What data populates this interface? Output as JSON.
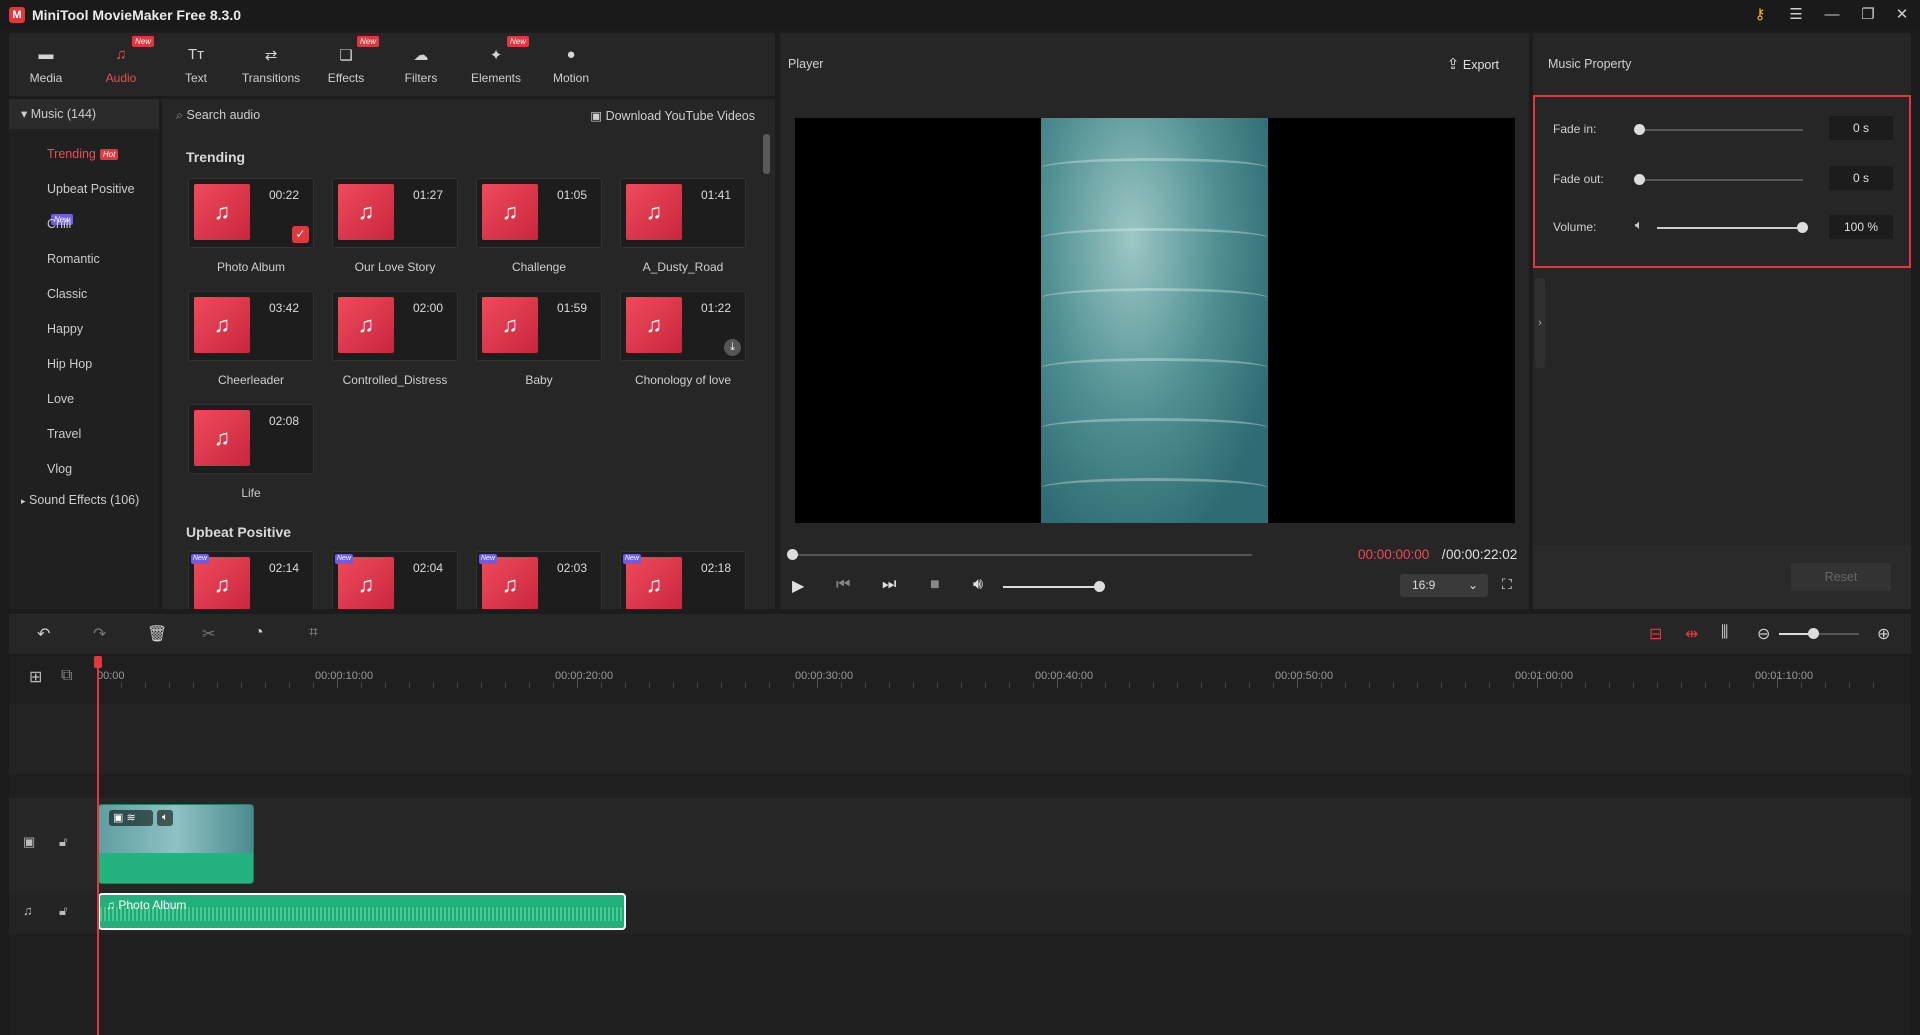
{
  "app": {
    "title": "MiniTool MovieMaker Free 8.3.0",
    "logo_letter": "M"
  },
  "toolbar": {
    "items": [
      {
        "label": "Media",
        "new": false,
        "active": false
      },
      {
        "label": "Audio",
        "new": true,
        "active": true
      },
      {
        "label": "Text",
        "new": false,
        "active": false
      },
      {
        "label": "Transitions",
        "new": false,
        "active": false
      },
      {
        "label": "Effects",
        "new": true,
        "active": false
      },
      {
        "label": "Filters",
        "new": false,
        "active": false
      },
      {
        "label": "Elements",
        "new": true,
        "active": false
      },
      {
        "label": "Motion",
        "new": false,
        "active": false
      }
    ],
    "new_tag": "New"
  },
  "sidebar": {
    "music_header": "Music (144)",
    "categories": [
      {
        "label": "Trending",
        "badge": "Hot"
      },
      {
        "label": "Upbeat Positive",
        "badge": "New"
      },
      {
        "label": "Chill"
      },
      {
        "label": "Romantic"
      },
      {
        "label": "Classic"
      },
      {
        "label": "Happy"
      },
      {
        "label": "Hip Hop"
      },
      {
        "label": "Love"
      },
      {
        "label": "Travel"
      },
      {
        "label": "Vlog"
      }
    ],
    "sound_effects": "Sound Effects (106)"
  },
  "library": {
    "search_placeholder": "Search audio",
    "download_label": "Download YouTube Videos",
    "section1": "Trending",
    "section2": "Upbeat Positive",
    "trending": [
      {
        "name": "Photo Album",
        "duration": "00:22"
      },
      {
        "name": "Our Love Story",
        "duration": "01:27"
      },
      {
        "name": "Challenge",
        "duration": "01:05"
      },
      {
        "name": "A_Dusty_Road",
        "duration": "01:41"
      },
      {
        "name": "Cheerleader",
        "duration": "03:42"
      },
      {
        "name": "Controlled_Distress",
        "duration": "02:00"
      },
      {
        "name": "Baby",
        "duration": "01:59"
      },
      {
        "name": "Chonology of love",
        "duration": "01:22"
      },
      {
        "name": "Life",
        "duration": "02:08"
      }
    ],
    "upbeat": [
      {
        "duration": "02:14"
      },
      {
        "duration": "02:04"
      },
      {
        "duration": "02:03"
      },
      {
        "duration": "02:18"
      }
    ],
    "new_small": "New"
  },
  "player": {
    "title": "Player",
    "export_label": "Export",
    "current_time": "00:00:00:00",
    "separator": " / ",
    "total_time": "00:00:22:02",
    "ratio": "16:9",
    "progress": 0,
    "volume": 1.0
  },
  "music_property": {
    "title": "Music Property",
    "fade_in_label": "Fade in:",
    "fade_in_value": "0 s",
    "fade_out_label": "Fade out:",
    "fade_out_value": "0 s",
    "volume_label": "Volume:",
    "volume_value": "100 %",
    "reset_label": "Reset"
  },
  "timeline": {
    "ruler": [
      "00:00",
      "00:00:10:00",
      "00:00:20:00",
      "00:00:30:00",
      "00:00:40:00",
      "00:00:50:00",
      "00:01:00:00",
      "00:01:10:00"
    ],
    "audio_clip_label": "Photo Album"
  },
  "colors": {
    "accent": "#e0383e",
    "audio_clip": "#22b07c"
  }
}
